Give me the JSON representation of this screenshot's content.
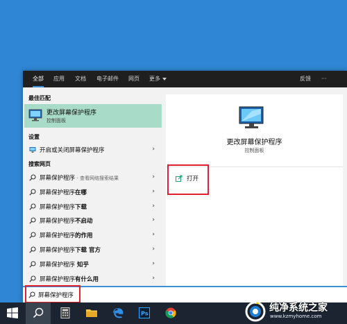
{
  "tabs": [
    "全部",
    "应用",
    "文档",
    "电子邮件",
    "网页"
  ],
  "tab_more": "更多",
  "tab_feedback": "反馈",
  "tab_ellipsis": "···",
  "best_match": {
    "section": "最佳匹配",
    "title": "更改屏幕保护程序",
    "subtitle": "控制面板"
  },
  "settings": {
    "section": "设置",
    "item": "开启或关闭屏幕保护程序"
  },
  "web": {
    "section": "搜索网页",
    "items": [
      {
        "main": "屏幕保护程序",
        "bold": "",
        "suffix": " - 查看网络搜索结果"
      },
      {
        "main": "屏幕保护程序",
        "bold": "在哪",
        "suffix": ""
      },
      {
        "main": "屏幕保护程序",
        "bold": "下载",
        "suffix": ""
      },
      {
        "main": "屏幕保护程序",
        "bold": "不启动",
        "suffix": ""
      },
      {
        "main": "屏幕保护程序",
        "bold": "的作用",
        "suffix": ""
      },
      {
        "main": "屏幕保护程序",
        "bold": "下载 官方",
        "suffix": ""
      },
      {
        "main": "屏幕保护程序",
        "bold": " 知乎",
        "suffix": ""
      },
      {
        "main": "屏幕保护程序",
        "bold": "有什么用",
        "suffix": ""
      }
    ]
  },
  "preview": {
    "title": "更改屏幕保护程序",
    "subtitle": "控制面板",
    "open_label": "打开"
  },
  "search": {
    "value": "屏幕保护程序"
  },
  "watermark": {
    "text": "纯净系统之家",
    "url": "www.kzmyhome.com"
  },
  "colors": {
    "accent": "#3b8fd9",
    "highlight": "#e0202a",
    "best_bg": "#a9dcc8",
    "desktop": "#2f86d4"
  }
}
